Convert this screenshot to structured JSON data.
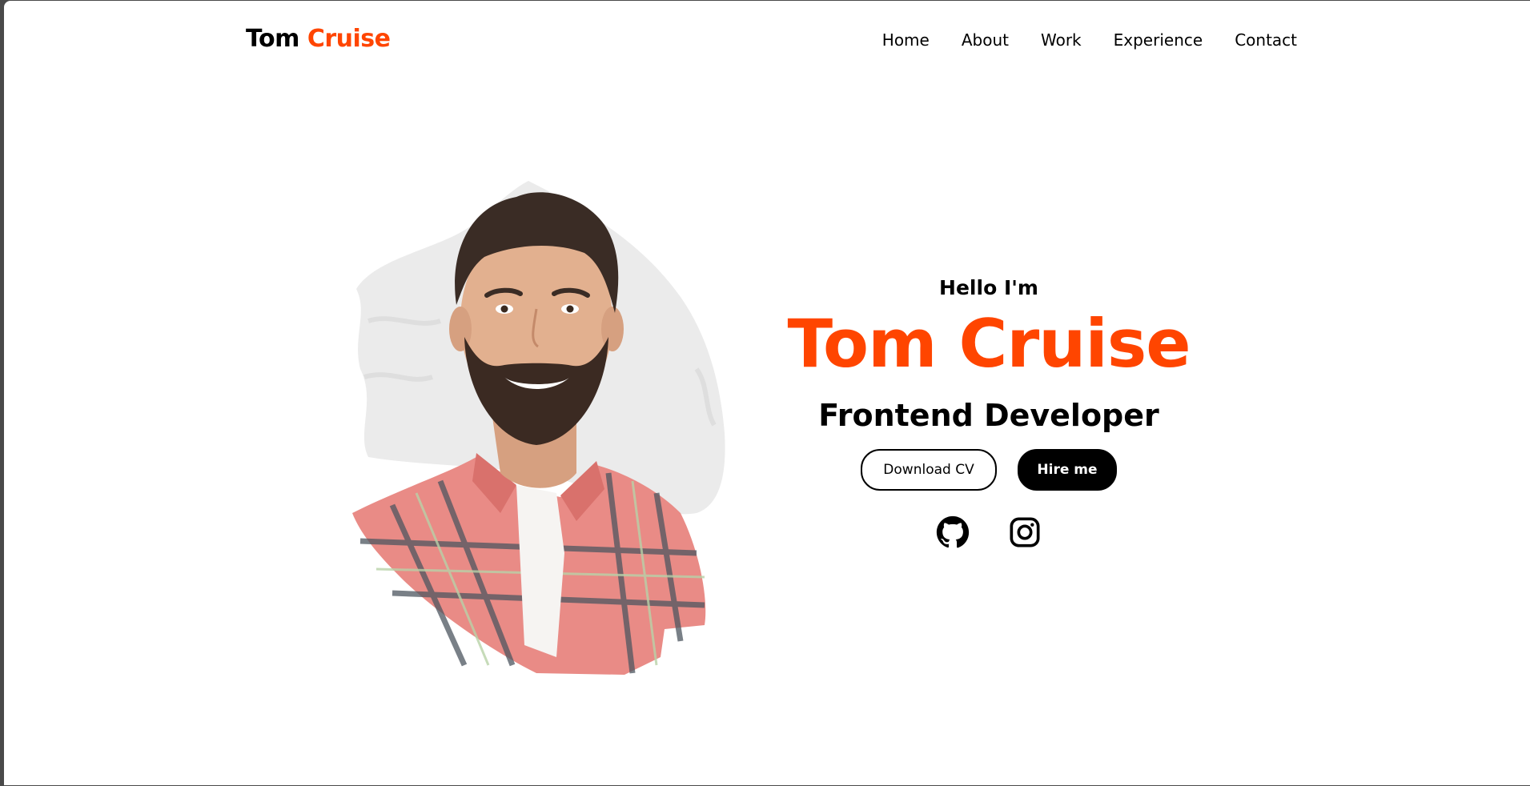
{
  "brand": {
    "first": "Tom",
    "last": "Cruise"
  },
  "nav": {
    "items": [
      {
        "label": "Home"
      },
      {
        "label": "About"
      },
      {
        "label": "Work"
      },
      {
        "label": "Experience"
      },
      {
        "label": "Contact"
      }
    ]
  },
  "hero": {
    "greeting": "Hello I'm",
    "name": "Tom Cruise",
    "role": "Frontend Developer",
    "download_label": "Download CV",
    "hire_label": "Hire me"
  },
  "socials": [
    {
      "icon": "github-icon"
    },
    {
      "icon": "instagram-icon"
    }
  ],
  "colors": {
    "accent": "#ff4500",
    "text": "#000000",
    "background": "#ffffff"
  }
}
